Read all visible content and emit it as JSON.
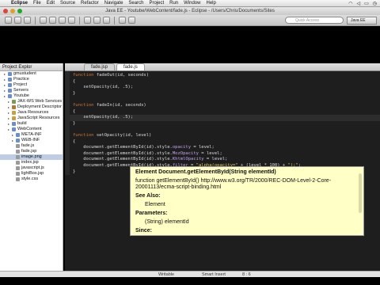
{
  "menubar": {
    "items": [
      "Eclipse",
      "File",
      "Edit",
      "Source",
      "Refactor",
      "Navigate",
      "Search",
      "Project",
      "Run",
      "Window",
      "Help"
    ],
    "status_icons": [
      "wifi-icon",
      "volume-icon",
      "battery-icon",
      "clock-icon"
    ]
  },
  "window": {
    "title": "Java EE - Youtube/WebContent/fade.js - Eclipse - /Users/Chris/Documents/Sites"
  },
  "toolbar": {
    "quick_access_placeholder": "Quick Access",
    "perspective_label": "Java EE"
  },
  "explorer": {
    "title": "Project Explor",
    "items": [
      {
        "label": "gmustudent",
        "indent": 1,
        "icon": "folder"
      },
      {
        "label": "Practice",
        "indent": 1,
        "icon": "folder"
      },
      {
        "label": "Project",
        "indent": 1,
        "icon": "folder"
      },
      {
        "label": "Servers",
        "indent": 1,
        "icon": "folder"
      },
      {
        "label": "Youtube",
        "indent": 1,
        "icon": "folder"
      },
      {
        "label": "JAX-WS Web Services",
        "indent": 2,
        "icon": "service"
      },
      {
        "label": "Deployment Descriptor",
        "indent": 2,
        "icon": "descriptor"
      },
      {
        "label": "Java Resources",
        "indent": 2,
        "icon": "package"
      },
      {
        "label": "JavaScript Resources",
        "indent": 2,
        "icon": "package"
      },
      {
        "label": "build",
        "indent": 2,
        "icon": "folder"
      },
      {
        "label": "WebContent",
        "indent": 2,
        "icon": "folder"
      },
      {
        "label": "META-INF",
        "indent": 3,
        "icon": "folder"
      },
      {
        "label": "WEB-INF",
        "indent": 3,
        "icon": "folder"
      },
      {
        "label": "fade.js",
        "indent": 3,
        "icon": "file"
      },
      {
        "label": "fade.jsp",
        "indent": 3,
        "icon": "file"
      },
      {
        "label": "image.png",
        "indent": 3,
        "icon": "file",
        "selected": true
      },
      {
        "label": "index.jsp",
        "indent": 3,
        "icon": "file"
      },
      {
        "label": "javascript.js",
        "indent": 3,
        "icon": "file"
      },
      {
        "label": "lightBox.jsp",
        "indent": 3,
        "icon": "file"
      },
      {
        "label": "style.css",
        "indent": 3,
        "icon": "file"
      }
    ]
  },
  "editor": {
    "tabs": [
      {
        "label": "fade.jsp",
        "active": false
      },
      {
        "label": "fade.js",
        "active": true
      }
    ],
    "lines": [
      [
        {
          "t": "function ",
          "c": "kw"
        },
        {
          "t": "fadeOut(id, seconds)"
        }
      ],
      [
        {
          "t": "{"
        }
      ],
      [
        {
          "t": "    setOpacity(id, .5);"
        }
      ],
      [
        {
          "t": "}"
        }
      ],
      [
        {
          "t": ""
        }
      ],
      [
        {
          "t": "function ",
          "c": "kw"
        },
        {
          "t": "fadeIn(id, seconds)"
        }
      ],
      [
        {
          "t": "{"
        }
      ],
      [
        {
          "t": "    setOpacity(id, .5);"
        }
      ],
      [
        {
          "t": "}"
        }
      ],
      [
        {
          "t": ""
        }
      ],
      [
        {
          "t": "function ",
          "c": "kw"
        },
        {
          "t": "setOpacity(id, level)"
        }
      ],
      [
        {
          "t": "{"
        }
      ],
      [
        {
          "t": "    document.getElementById(id).style."
        },
        {
          "t": "opacity",
          "c": "fld"
        },
        {
          "t": " = level;"
        }
      ],
      [
        {
          "t": "    document.getElementById(id).style."
        },
        {
          "t": "MozOpacity",
          "c": "fld"
        },
        {
          "t": " = level;"
        }
      ],
      [
        {
          "t": "    document.getElementById(id).style."
        },
        {
          "t": "KhtmlOpacity",
          "c": "fld"
        },
        {
          "t": " = level;"
        }
      ],
      [
        {
          "t": "    document.getElementById(id).style."
        },
        {
          "t": "filter",
          "c": "fld"
        },
        {
          "t": " = "
        },
        {
          "t": "\"alpha(opacity=\"",
          "c": "str"
        },
        {
          "t": " + (level * 100) + "
        },
        {
          "t": "\");\"",
          "c": "str"
        },
        {
          "t": ";"
        }
      ],
      [
        {
          "t": "}"
        }
      ]
    ],
    "highlight_line": 7
  },
  "popup": {
    "signature": "Element Document.getElementById(String elementId)",
    "description": "function getElementById() http://www.w3.org/TR/2000/REC-DOM-Level-2-Core-20001113/ecma-script-binding.html",
    "see_also_label": "See Also:",
    "see_also_value": "Element",
    "parameters_label": "Parameters:",
    "parameters_value": "(String) elementId",
    "since_label": "Since:"
  },
  "statusbar": {
    "mode": "Writable",
    "insert": "Smart Insert",
    "position": "8 : 6"
  },
  "colors": {
    "editor_bg": "#1e1e1e",
    "keyword": "#cc7832",
    "string": "#e0c060",
    "popup_bg": "#ffffc6"
  }
}
